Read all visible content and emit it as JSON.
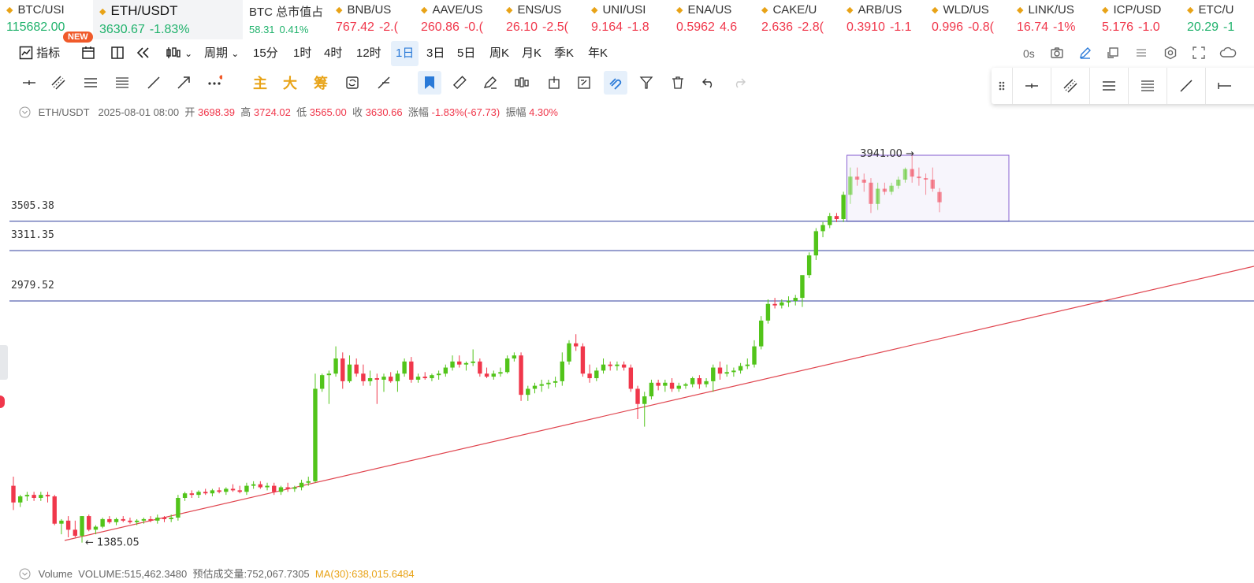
{
  "tickers": [
    {
      "symbol": "BTC/USI",
      "price": "115682.00",
      "change": "",
      "trend": "green",
      "style": "normal",
      "width": 118
    },
    {
      "symbol": "ETH/USDT",
      "price": "3630.67",
      "change": "-1.83%",
      "trend": "green",
      "style": "active",
      "width": 190
    },
    {
      "symbol": "BTC 总市值占",
      "price": "58.31",
      "change": "0.41%",
      "trend": "green",
      "style": "small",
      "width": 110
    },
    {
      "symbol": "BNB/US",
      "price": "767.42",
      "change": "-2.(",
      "trend": "red",
      "style": "normal",
      "width": 108
    },
    {
      "symbol": "AAVE/US",
      "price": "260.86",
      "change": "-0.(",
      "trend": "red",
      "style": "normal",
      "width": 108
    },
    {
      "symbol": "ENS/US",
      "price": "26.10",
      "change": "-2.5(",
      "trend": "red",
      "style": "normal",
      "width": 108
    },
    {
      "symbol": "UNI/USI",
      "price": "9.164",
      "change": "-1.8",
      "trend": "red",
      "style": "normal",
      "width": 108
    },
    {
      "symbol": "ENA/US",
      "price": "0.5962",
      "change": "4.6",
      "trend": "red",
      "style": "normal",
      "width": 108
    },
    {
      "symbol": "CAKE/U",
      "price": "2.636",
      "change": "-2.8(",
      "trend": "red",
      "style": "normal",
      "width": 108
    },
    {
      "symbol": "ARB/US",
      "price": "0.3910",
      "change": "-1.1",
      "trend": "red",
      "style": "normal",
      "width": 108
    },
    {
      "symbol": "WLD/US",
      "price": "0.996",
      "change": "-0.8(",
      "trend": "red",
      "style": "normal",
      "width": 108
    },
    {
      "symbol": "LINK/US",
      "price": "16.74",
      "change": "-1%",
      "trend": "red",
      "style": "normal",
      "width": 108
    },
    {
      "symbol": "ICP/USD",
      "price": "5.176",
      "change": "-1.0",
      "trend": "red",
      "style": "normal",
      "width": 108
    },
    {
      "symbol": "ETC/U",
      "price": "20.29",
      "change": "-1",
      "trend": "green",
      "style": "normal",
      "width": 90
    }
  ],
  "badge": "NEW",
  "toolbar": {
    "indicator": "指标",
    "period": "周期",
    "intervals": [
      "15分",
      "1时",
      "4时",
      "12时",
      "1日",
      "3日",
      "5日",
      "周K",
      "月K",
      "季K",
      "年K"
    ],
    "selected_interval": "1日",
    "countdown": "0s"
  },
  "draw_tools_text": [
    "主",
    "大",
    "筹"
  ],
  "info": {
    "pair": "ETH/USDT",
    "datetime": "2025-08-01 08:00",
    "open_label": "开",
    "open": "3698.39",
    "high_label": "高",
    "high": "3724.02",
    "low_label": "低",
    "low": "3565.00",
    "close_label": "收",
    "close": "3630.66",
    "chg_label": "涨幅",
    "chg": "-1.83%(-67.73)",
    "amp_label": "振幅",
    "amp": "4.30%"
  },
  "volume_line": {
    "label": "Volume",
    "volume": "VOLUME:515,462.3480",
    "estimate": "预估成交量:752,067.7305",
    "ma": "MA(30):638,015.6484"
  },
  "chart_data": {
    "type": "candlestick",
    "interval": "1D",
    "horizontal_lines": [
      3505.38,
      3311.35,
      2979.52
    ],
    "annotations": {
      "high": "3941.00",
      "low": "1385.05"
    },
    "colors": {
      "up": "#52c41a",
      "down": "#f0374b",
      "hline": "#2f3d9c",
      "trend": "#e0454f",
      "box": "#8a63d2"
    },
    "candles": [
      {
        "o": 1760,
        "h": 1820,
        "l": 1600,
        "c": 1650
      },
      {
        "o": 1650,
        "h": 1700,
        "l": 1620,
        "c": 1690
      },
      {
        "o": 1690,
        "h": 1720,
        "l": 1660,
        "c": 1700
      },
      {
        "o": 1700,
        "h": 1720,
        "l": 1660,
        "c": 1680
      },
      {
        "o": 1680,
        "h": 1720,
        "l": 1660,
        "c": 1700
      },
      {
        "o": 1700,
        "h": 1720,
        "l": 1650,
        "c": 1690
      },
      {
        "o": 1690,
        "h": 1700,
        "l": 1500,
        "c": 1510
      },
      {
        "o": 1510,
        "h": 1540,
        "l": 1440,
        "c": 1530
      },
      {
        "o": 1530,
        "h": 1560,
        "l": 1420,
        "c": 1470
      },
      {
        "o": 1470,
        "h": 1530,
        "l": 1420,
        "c": 1430
      },
      {
        "o": 1430,
        "h": 1560,
        "l": 1385,
        "c": 1560
      },
      {
        "o": 1560,
        "h": 1570,
        "l": 1460,
        "c": 1470
      },
      {
        "o": 1470,
        "h": 1500,
        "l": 1440,
        "c": 1490
      },
      {
        "o": 1490,
        "h": 1550,
        "l": 1480,
        "c": 1540
      },
      {
        "o": 1540,
        "h": 1560,
        "l": 1510,
        "c": 1520
      },
      {
        "o": 1520,
        "h": 1550,
        "l": 1500,
        "c": 1540
      },
      {
        "o": 1540,
        "h": 1560,
        "l": 1520,
        "c": 1530
      },
      {
        "o": 1530,
        "h": 1550,
        "l": 1510,
        "c": 1520
      },
      {
        "o": 1520,
        "h": 1540,
        "l": 1500,
        "c": 1530
      },
      {
        "o": 1530,
        "h": 1550,
        "l": 1510,
        "c": 1540
      },
      {
        "o": 1540,
        "h": 1560,
        "l": 1520,
        "c": 1530
      },
      {
        "o": 1530,
        "h": 1570,
        "l": 1510,
        "c": 1550
      },
      {
        "o": 1550,
        "h": 1560,
        "l": 1520,
        "c": 1540
      },
      {
        "o": 1540,
        "h": 1570,
        "l": 1520,
        "c": 1550
      },
      {
        "o": 1550,
        "h": 1700,
        "l": 1530,
        "c": 1680
      },
      {
        "o": 1680,
        "h": 1720,
        "l": 1660,
        "c": 1710
      },
      {
        "o": 1710,
        "h": 1730,
        "l": 1680,
        "c": 1700
      },
      {
        "o": 1700,
        "h": 1730,
        "l": 1680,
        "c": 1720
      },
      {
        "o": 1720,
        "h": 1740,
        "l": 1700,
        "c": 1710
      },
      {
        "o": 1710,
        "h": 1740,
        "l": 1690,
        "c": 1730
      },
      {
        "o": 1730,
        "h": 1750,
        "l": 1710,
        "c": 1720
      },
      {
        "o": 1720,
        "h": 1750,
        "l": 1700,
        "c": 1740
      },
      {
        "o": 1740,
        "h": 1770,
        "l": 1720,
        "c": 1730
      },
      {
        "o": 1730,
        "h": 1760,
        "l": 1710,
        "c": 1720
      },
      {
        "o": 1720,
        "h": 1780,
        "l": 1700,
        "c": 1760
      },
      {
        "o": 1760,
        "h": 1790,
        "l": 1740,
        "c": 1770
      },
      {
        "o": 1770,
        "h": 1790,
        "l": 1740,
        "c": 1750
      },
      {
        "o": 1750,
        "h": 1780,
        "l": 1730,
        "c": 1760
      },
      {
        "o": 1760,
        "h": 1780,
        "l": 1700,
        "c": 1720
      },
      {
        "o": 1720,
        "h": 1760,
        "l": 1700,
        "c": 1750
      },
      {
        "o": 1750,
        "h": 1780,
        "l": 1720,
        "c": 1740
      },
      {
        "o": 1740,
        "h": 1760,
        "l": 1720,
        "c": 1750
      },
      {
        "o": 1750,
        "h": 1800,
        "l": 1730,
        "c": 1780
      },
      {
        "o": 1780,
        "h": 1820,
        "l": 1760,
        "c": 1790
      },
      {
        "o": 1790,
        "h": 2500,
        "l": 1780,
        "c": 2400
      },
      {
        "o": 2400,
        "h": 2500,
        "l": 2380,
        "c": 2490
      },
      {
        "o": 2490,
        "h": 2520,
        "l": 2300,
        "c": 2500
      },
      {
        "o": 2500,
        "h": 2680,
        "l": 2480,
        "c": 2600
      },
      {
        "o": 2600,
        "h": 2640,
        "l": 2400,
        "c": 2450
      },
      {
        "o": 2450,
        "h": 2620,
        "l": 2440,
        "c": 2560
      },
      {
        "o": 2560,
        "h": 2600,
        "l": 2480,
        "c": 2500
      },
      {
        "o": 2500,
        "h": 2560,
        "l": 2420,
        "c": 2450
      },
      {
        "o": 2450,
        "h": 2520,
        "l": 2420,
        "c": 2470
      },
      {
        "o": 2470,
        "h": 2500,
        "l": 2300,
        "c": 2460
      },
      {
        "o": 2460,
        "h": 2500,
        "l": 2380,
        "c": 2480
      },
      {
        "o": 2480,
        "h": 2510,
        "l": 2440,
        "c": 2450
      },
      {
        "o": 2450,
        "h": 2520,
        "l": 2380,
        "c": 2500
      },
      {
        "o": 2500,
        "h": 2600,
        "l": 2480,
        "c": 2580
      },
      {
        "o": 2580,
        "h": 2610,
        "l": 2440,
        "c": 2460
      },
      {
        "o": 2460,
        "h": 2500,
        "l": 2440,
        "c": 2480
      },
      {
        "o": 2480,
        "h": 2510,
        "l": 2460,
        "c": 2470
      },
      {
        "o": 2470,
        "h": 2500,
        "l": 2450,
        "c": 2490
      },
      {
        "o": 2490,
        "h": 2520,
        "l": 2460,
        "c": 2500
      },
      {
        "o": 2500,
        "h": 2560,
        "l": 2480,
        "c": 2540
      },
      {
        "o": 2540,
        "h": 2620,
        "l": 2520,
        "c": 2580
      },
      {
        "o": 2580,
        "h": 2620,
        "l": 2540,
        "c": 2560
      },
      {
        "o": 2560,
        "h": 2580,
        "l": 2520,
        "c": 2570
      },
      {
        "o": 2570,
        "h": 2660,
        "l": 2550,
        "c": 2580
      },
      {
        "o": 2580,
        "h": 2600,
        "l": 2480,
        "c": 2500
      },
      {
        "o": 2500,
        "h": 2540,
        "l": 2470,
        "c": 2480
      },
      {
        "o": 2480,
        "h": 2520,
        "l": 2460,
        "c": 2500
      },
      {
        "o": 2500,
        "h": 2540,
        "l": 2480,
        "c": 2510
      },
      {
        "o": 2510,
        "h": 2620,
        "l": 2500,
        "c": 2600
      },
      {
        "o": 2600,
        "h": 2640,
        "l": 2580,
        "c": 2620
      },
      {
        "o": 2620,
        "h": 2640,
        "l": 2320,
        "c": 2360
      },
      {
        "o": 2360,
        "h": 2420,
        "l": 2320,
        "c": 2400
      },
      {
        "o": 2400,
        "h": 2440,
        "l": 2370,
        "c": 2420
      },
      {
        "o": 2420,
        "h": 2460,
        "l": 2380,
        "c": 2430
      },
      {
        "o": 2430,
        "h": 2460,
        "l": 2400,
        "c": 2440
      },
      {
        "o": 2440,
        "h": 2480,
        "l": 2410,
        "c": 2450
      },
      {
        "o": 2450,
        "h": 2640,
        "l": 2420,
        "c": 2580
      },
      {
        "o": 2580,
        "h": 2720,
        "l": 2560,
        "c": 2700
      },
      {
        "o": 2700,
        "h": 2760,
        "l": 2650,
        "c": 2680
      },
      {
        "o": 2680,
        "h": 2700,
        "l": 2480,
        "c": 2500
      },
      {
        "o": 2500,
        "h": 2560,
        "l": 2440,
        "c": 2470
      },
      {
        "o": 2470,
        "h": 2540,
        "l": 2450,
        "c": 2520
      },
      {
        "o": 2520,
        "h": 2600,
        "l": 2500,
        "c": 2560
      },
      {
        "o": 2560,
        "h": 2580,
        "l": 2520,
        "c": 2550
      },
      {
        "o": 2550,
        "h": 2580,
        "l": 2520,
        "c": 2560
      },
      {
        "o": 2560,
        "h": 2580,
        "l": 2520,
        "c": 2540
      },
      {
        "o": 2540,
        "h": 2560,
        "l": 2380,
        "c": 2400
      },
      {
        "o": 2400,
        "h": 2420,
        "l": 2200,
        "c": 2300
      },
      {
        "o": 2300,
        "h": 2380,
        "l": 2150,
        "c": 2350
      },
      {
        "o": 2350,
        "h": 2460,
        "l": 2330,
        "c": 2440
      },
      {
        "o": 2440,
        "h": 2460,
        "l": 2390,
        "c": 2420
      },
      {
        "o": 2420,
        "h": 2460,
        "l": 2380,
        "c": 2440
      },
      {
        "o": 2440,
        "h": 2470,
        "l": 2380,
        "c": 2400
      },
      {
        "o": 2400,
        "h": 2440,
        "l": 2380,
        "c": 2420
      },
      {
        "o": 2420,
        "h": 2440,
        "l": 2400,
        "c": 2430
      },
      {
        "o": 2430,
        "h": 2480,
        "l": 2410,
        "c": 2470
      },
      {
        "o": 2470,
        "h": 2490,
        "l": 2400,
        "c": 2430
      },
      {
        "o": 2430,
        "h": 2470,
        "l": 2410,
        "c": 2450
      },
      {
        "o": 2450,
        "h": 2560,
        "l": 2380,
        "c": 2540
      },
      {
        "o": 2540,
        "h": 2580,
        "l": 2460,
        "c": 2500
      },
      {
        "o": 2500,
        "h": 2560,
        "l": 2480,
        "c": 2510
      },
      {
        "o": 2510,
        "h": 2540,
        "l": 2480,
        "c": 2520
      },
      {
        "o": 2520,
        "h": 2570,
        "l": 2500,
        "c": 2550
      },
      {
        "o": 2550,
        "h": 2600,
        "l": 2530,
        "c": 2560
      },
      {
        "o": 2560,
        "h": 2720,
        "l": 2540,
        "c": 2680
      },
      {
        "o": 2680,
        "h": 2880,
        "l": 2660,
        "c": 2850
      },
      {
        "o": 2850,
        "h": 2990,
        "l": 2830,
        "c": 2960
      },
      {
        "o": 2960,
        "h": 3000,
        "l": 2930,
        "c": 2950
      },
      {
        "o": 2950,
        "h": 2990,
        "l": 2930,
        "c": 2970
      },
      {
        "o": 2970,
        "h": 3010,
        "l": 2940,
        "c": 2980
      },
      {
        "o": 2980,
        "h": 3020,
        "l": 2950,
        "c": 3000
      },
      {
        "o": 3000,
        "h": 3060,
        "l": 2940,
        "c": 3150
      },
      {
        "o": 3150,
        "h": 3300,
        "l": 3130,
        "c": 3280
      },
      {
        "o": 3280,
        "h": 3460,
        "l": 3250,
        "c": 3440
      },
      {
        "o": 3440,
        "h": 3500,
        "l": 3400,
        "c": 3480
      },
      {
        "o": 3480,
        "h": 3560,
        "l": 3460,
        "c": 3540
      },
      {
        "o": 3540,
        "h": 3560,
        "l": 3500,
        "c": 3520
      },
      {
        "o": 3520,
        "h": 3700,
        "l": 3500,
        "c": 3680
      },
      {
        "o": 3680,
        "h": 3860,
        "l": 3620,
        "c": 3800
      },
      {
        "o": 3800,
        "h": 3860,
        "l": 3740,
        "c": 3780
      },
      {
        "o": 3780,
        "h": 3820,
        "l": 3700,
        "c": 3760
      },
      {
        "o": 3760,
        "h": 3790,
        "l": 3560,
        "c": 3620
      },
      {
        "o": 3620,
        "h": 3760,
        "l": 3580,
        "c": 3720
      },
      {
        "o": 3720,
        "h": 3760,
        "l": 3680,
        "c": 3700
      },
      {
        "o": 3700,
        "h": 3760,
        "l": 3680,
        "c": 3740
      },
      {
        "o": 3740,
        "h": 3800,
        "l": 3720,
        "c": 3780
      },
      {
        "o": 3780,
        "h": 3860,
        "l": 3760,
        "c": 3850
      },
      {
        "o": 3850,
        "h": 3941,
        "l": 3760,
        "c": 3800
      },
      {
        "o": 3800,
        "h": 3860,
        "l": 3740,
        "c": 3790
      },
      {
        "o": 3790,
        "h": 3820,
        "l": 3680,
        "c": 3780
      },
      {
        "o": 3780,
        "h": 3860,
        "l": 3700,
        "c": 3720
      },
      {
        "o": 3698.39,
        "h": 3724.02,
        "l": 3565.0,
        "c": 3630.66
      }
    ]
  }
}
